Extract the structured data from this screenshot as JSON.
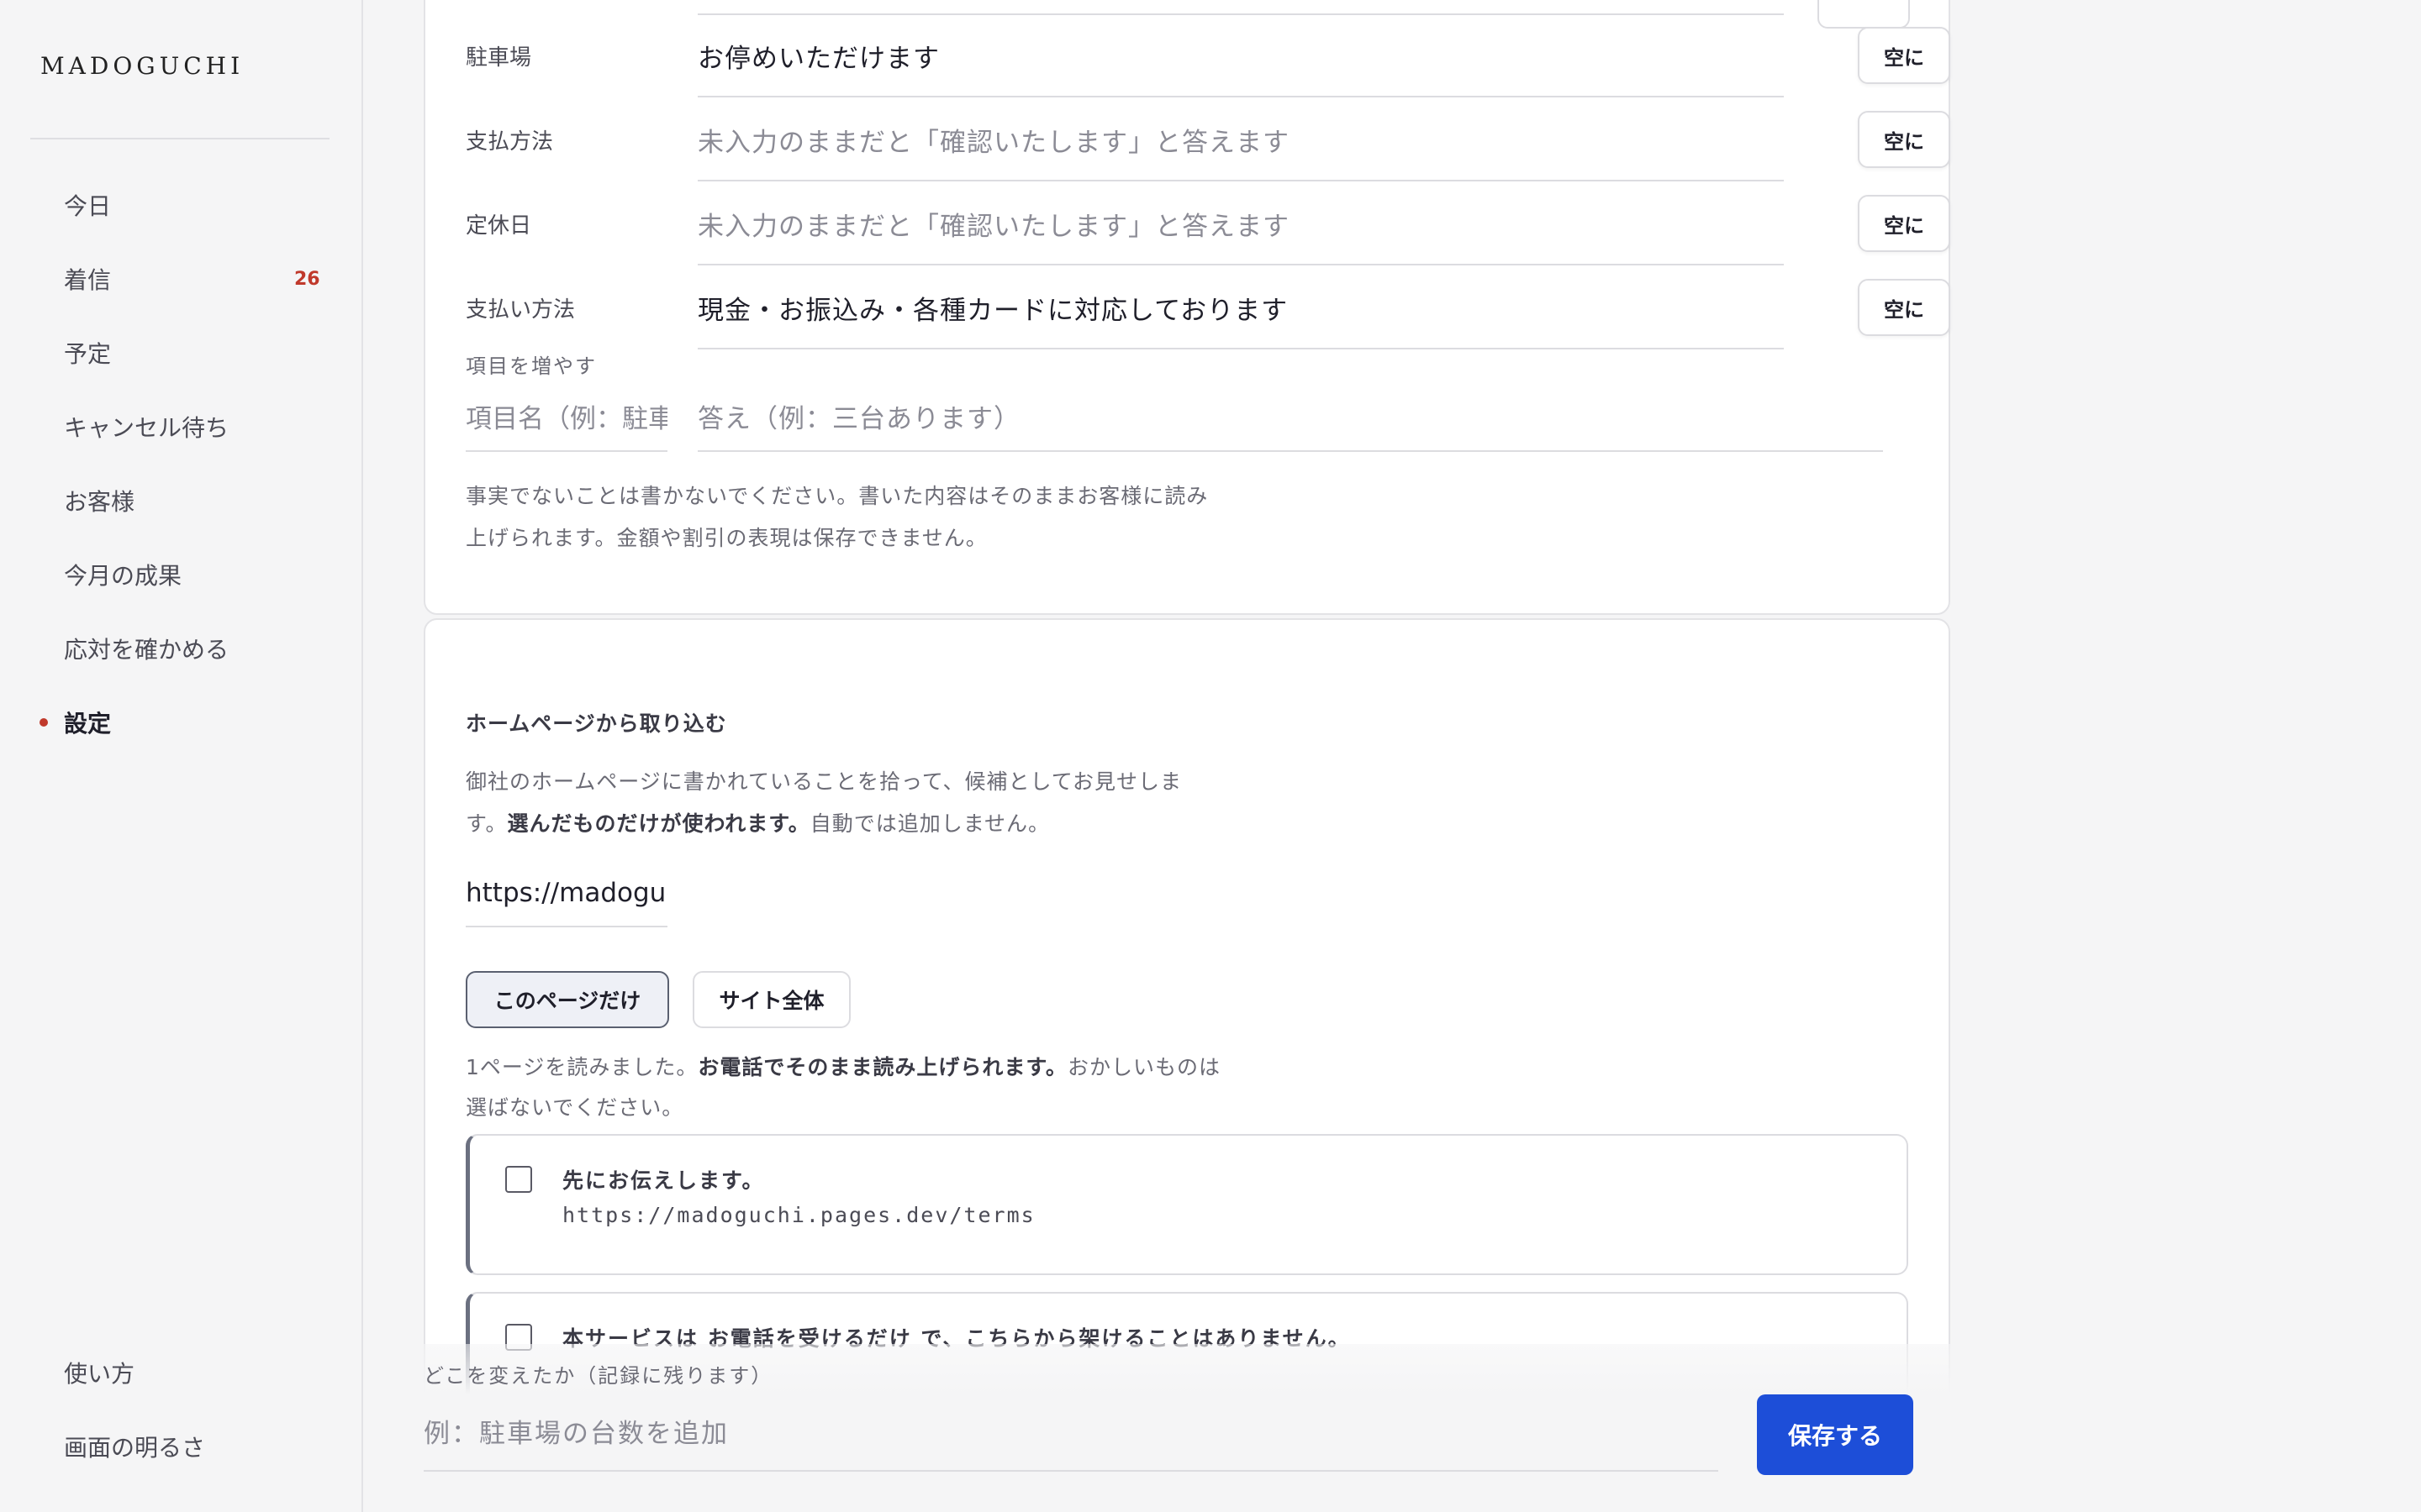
{
  "app": {
    "brand": "MADOGUCHI"
  },
  "sidebar": {
    "items": [
      {
        "label": "今日"
      },
      {
        "label": "着信",
        "badge": "26"
      },
      {
        "label": "予定"
      },
      {
        "label": "キャンセル待ち"
      },
      {
        "label": "お客様"
      },
      {
        "label": "今月の成果"
      },
      {
        "label": "応対を確かめる"
      },
      {
        "label": "設定",
        "active": true
      }
    ],
    "bottom_items": [
      {
        "label": "使い方"
      },
      {
        "label": "画面の明るさ"
      }
    ]
  },
  "faq": {
    "rows": [
      {
        "label": "駐車場",
        "answer": "お停めいただけます",
        "is_placeholder": false,
        "clear_label": "空に"
      },
      {
        "label": "支払方法",
        "answer": "未入力のままだと「確認いたします」と答えます",
        "is_placeholder": true,
        "clear_label": "空に"
      },
      {
        "label": "定休日",
        "answer": "未入力のままだと「確認いたします」と答えます",
        "is_placeholder": true,
        "clear_label": "空に"
      },
      {
        "label": "支払い方法",
        "answer": "現金・お振込み・各種カードに対応しております",
        "is_placeholder": false,
        "clear_label": "空に"
      }
    ],
    "add_label": "項目を増やす",
    "add_name_placeholder": "項目名（例：駐車場）",
    "add_answer_placeholder": "答え（例：三台あります）",
    "note_line1": "事実でないことは書かないでください。書いた内容はそのままお客様に読み",
    "note_line2": "上げられます。金額や割引の表現は保存できません。"
  },
  "import": {
    "title": "ホームページから取り込む",
    "desc_line1": "御社のホームページに書かれていることを拾って、候補としてお見せしま",
    "desc_line2_pre": "す。",
    "desc_line2_bold": "選んだものだけが使われます。",
    "desc_line2_post": "自動では追加しません。",
    "url_value": "https://madoguchi.pages.dev",
    "scope_this_page": "このページだけ",
    "scope_whole_site": "サイト全体",
    "result_pre": "1ページを読みました。",
    "result_bold": "お電話でそのまま読み上げられます。",
    "result_post": "おかしいものは",
    "result_line2": "選ばないでください。",
    "candidates": [
      {
        "title": "先にお伝えします。",
        "url": "https://madoguchi.pages.dev/terms"
      },
      {
        "title": "本サービスは お電話を受けるだけ で、こちらから架けることはありません。"
      }
    ]
  },
  "savebar": {
    "note": "どこを変えたか（記録に残ります）",
    "placeholder": "例：駐車場の台数を追加",
    "save_label": "保存する"
  },
  "colors": {
    "accent": "#1d4ed8",
    "badge": "#c0392b"
  }
}
